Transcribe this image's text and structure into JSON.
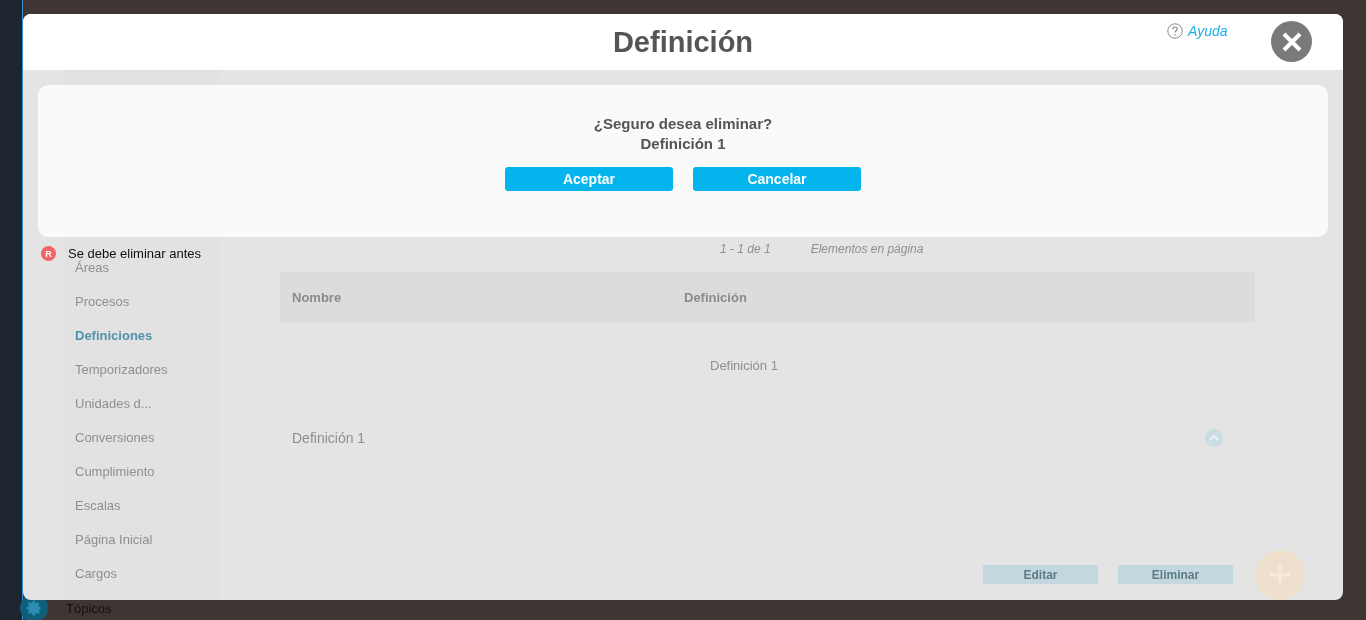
{
  "dialog": {
    "title": "Definición",
    "help_link": "Ayuda"
  },
  "confirm": {
    "question": "¿Seguro desea eliminar?",
    "item": "Definición 1",
    "buttons": [
      "Aceptar",
      "Cancelar"
    ]
  },
  "note": {
    "badge": "R",
    "text": "Se debe eliminar antes"
  },
  "background": {
    "sidebar": [
      {
        "label": "Áreas",
        "selected": false
      },
      {
        "label": "Procesos",
        "selected": false
      },
      {
        "label": "Definiciones",
        "selected": true
      },
      {
        "label": "Temporizadores",
        "selected": false
      },
      {
        "label": "Unidades d...",
        "selected": false
      },
      {
        "label": "Conversiones",
        "selected": false
      },
      {
        "label": "Cumplimiento",
        "selected": false
      },
      {
        "label": "Escalas",
        "selected": false
      },
      {
        "label": "Página Inicial",
        "selected": false
      },
      {
        "label": "Cargos",
        "selected": false
      }
    ],
    "sidebar_footer": "Tópicos",
    "pager": "1 - 1 de 1",
    "page_size_placeholder": "Elementos en página",
    "table": {
      "columns": [
        "Nombre",
        "Definición"
      ],
      "rows": [
        [
          "",
          "Definición 1"
        ]
      ]
    },
    "detail": {
      "title": "Definición 1",
      "buttons": [
        "Editar",
        "Eliminar"
      ]
    }
  }
}
